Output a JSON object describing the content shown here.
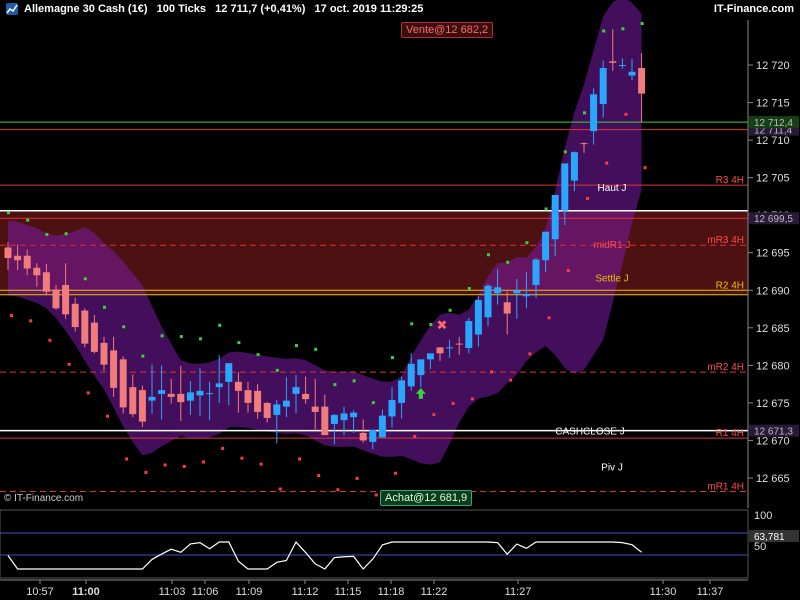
{
  "header": {
    "title": "Allemagne 30 Cash (1€)   100 Ticks   12 711,7 (+0,41%)   17 oct. 2019 11:29:25",
    "brand": "IT-Finance.com",
    "icon": "chart-app-icon"
  },
  "orders": {
    "sell": "Vente@12 682,2",
    "buy": "Achat@12 681,9"
  },
  "copyright": "© IT-Finance.com",
  "colors": {
    "bull": "#2aa6ff",
    "bear": "#f07c7c",
    "band_fill": "#7a1aa6",
    "zone_fill": "#5a1414",
    "support": "#3ad13a",
    "resistance": "#ff3b3b"
  },
  "chart_data": {
    "type": "candlestick",
    "instrument": "Allemagne 30 Cash (1€)",
    "timeframe": "100 Ticks",
    "ylim": [
      12661,
      12726
    ],
    "y_ticks": [
      "12 720",
      "12 715",
      "12 710",
      "12 705",
      "12 700",
      "12 695",
      "12 690",
      "12 685",
      "12 680",
      "12 675",
      "12 670",
      "12 665"
    ],
    "x_ticks": [
      "10:57",
      "11:00",
      "11:03",
      "11:06",
      "11:09",
      "11:12",
      "11:15",
      "11:18",
      "11:22",
      "11:27",
      "11:30",
      "11:37"
    ],
    "candles": [
      [
        12695.7,
        12696.4,
        12692.7,
        12694.3
      ],
      [
        12694.6,
        12696.1,
        12692.7,
        12694.0
      ],
      [
        12694.6,
        12695.4,
        12692.0,
        12692.9
      ],
      [
        12693.0,
        12693.6,
        12690.5,
        12692.0
      ],
      [
        12692.4,
        12693.5,
        12689.4,
        12689.8
      ],
      [
        12690.1,
        12690.7,
        12687.4,
        12687.6
      ],
      [
        12690.7,
        12693.6,
        12686.2,
        12686.8
      ],
      [
        12688.2,
        12689.0,
        12684.5,
        12685.1
      ],
      [
        12687.3,
        12687.6,
        12682.4,
        12682.9
      ],
      [
        12685.7,
        12686.7,
        12681.6,
        12681.8
      ],
      [
        12683.0,
        12683.8,
        12679.3,
        12680.1
      ],
      [
        12682.0,
        12683.8,
        12675.8,
        12677.0
      ],
      [
        12680.8,
        12681.2,
        12673.6,
        12674.4
      ],
      [
        12677.1,
        12678.8,
        12673.1,
        12673.5
      ],
      [
        12676.7,
        12677.3,
        12671.8,
        12672.5
      ],
      [
        12675.3,
        12680.1,
        12673.5,
        12675.8
      ],
      [
        12676.2,
        12680.0,
        12672.8,
        12676.7
      ],
      [
        12676.2,
        12678.2,
        12674.9,
        12675.8
      ],
      [
        12676.2,
        12679.9,
        12672.6,
        12675.1
      ],
      [
        12675.3,
        12677.9,
        12673.4,
        12676.4
      ],
      [
        12676.0,
        12679.6,
        12673.2,
        12676.6
      ],
      [
        12676.2,
        12677.8,
        12672.7,
        12676.3
      ],
      [
        12677.1,
        12681.4,
        12675.0,
        12677.6
      ],
      [
        12677.8,
        12680.0,
        12674.7,
        12680.3
      ],
      [
        12677.8,
        12679.1,
        12673.7,
        12676.6
      ],
      [
        12676.7,
        12677.8,
        12673.7,
        12675.0
      ],
      [
        12676.6,
        12677.5,
        12672.9,
        12673.8
      ],
      [
        12675.0,
        12675.1,
        12672.4,
        12673.0
      ],
      [
        12673.4,
        12675.4,
        12669.6,
        12674.8
      ],
      [
        12674.5,
        12678.4,
        12673.1,
        12675.3
      ],
      [
        12676.2,
        12678.7,
        12673.6,
        12677.1
      ],
      [
        12676.2,
        12678.5,
        12674.9,
        12675.5
      ],
      [
        12674.5,
        12678.2,
        12671.4,
        12673.8
      ],
      [
        12674.5,
        12676.1,
        12672.0,
        12670.7
      ],
      [
        12672.2,
        12673.5,
        12669.5,
        12673.4
      ],
      [
        12672.7,
        12674.5,
        12670.7,
        12673.6
      ],
      [
        12673.1,
        12674.0,
        12671.0,
        12673.7
      ],
      [
        12671.0,
        12672.8,
        12669.7,
        12670.0
      ],
      [
        12669.8,
        12671.1,
        12668.8,
        12671.4
      ],
      [
        12670.4,
        12674.1,
        12670.4,
        12673.3
      ],
      [
        12673.2,
        12677.1,
        12671.7,
        12675.4
      ],
      [
        12675.0,
        12678.5,
        12672.9,
        12678.0
      ],
      [
        12677.2,
        12681.6,
        12676.6,
        12680.2
      ],
      [
        12678.7,
        12680.4,
        12677.1,
        12680.8
      ],
      [
        12680.8,
        12681.5,
        12679.5,
        12681.6
      ],
      [
        12682.4,
        12682.2,
        12680.6,
        12681.6
      ],
      [
        12682.4,
        12683.4,
        12681.0,
        12682.4
      ],
      [
        12682.9,
        12683.8,
        12681.4,
        12682.8
      ],
      [
        12682.3,
        12686.3,
        12681.6,
        12685.9
      ],
      [
        12684.1,
        12689.2,
        12682.5,
        12688.7
      ],
      [
        12686.4,
        12690.8,
        12685.2,
        12690.6
      ],
      [
        12689.6,
        12692.8,
        12688.1,
        12690.4
      ],
      [
        12688.4,
        12689.8,
        12684.1,
        12686.9
      ],
      [
        12689.6,
        12691.5,
        12686.2,
        12690.0
      ],
      [
        12689.2,
        12692.4,
        12687.6,
        12689.5
      ],
      [
        12690.7,
        12694.3,
        12689.0,
        12694.1
      ],
      [
        12694.0,
        12696.9,
        12692.4,
        12697.8
      ],
      [
        12696.8,
        12701.1,
        12694.6,
        12702.7
      ],
      [
        12700.6,
        12704.5,
        12698.7,
        12706.9
      ],
      [
        12704.6,
        12708.5,
        12703.2,
        12708.4
      ],
      [
        12709.6,
        12709.7,
        12708.3,
        12709.5
      ],
      [
        12711.2,
        12716.9,
        12709.4,
        12716.1
      ],
      [
        12714.8,
        12720.6,
        12713.0,
        12719.6
      ],
      [
        12720.5,
        12724.8,
        12719.2,
        12720.3
      ],
      [
        12720.0,
        12720.9,
        12719.5,
        12720.0
      ],
      [
        12718.6,
        12720.8,
        12718.0,
        12719.1
      ],
      [
        12719.6,
        12721.6,
        12712.4,
        12716.2
      ]
    ],
    "levels": [
      {
        "value": 12711.4,
        "label": "12 711,4",
        "tag": true
      },
      {
        "value": 12712.4,
        "label": "12 712,4",
        "tag": true
      },
      {
        "value": 12704.0,
        "label": "R3 4H"
      },
      {
        "value": 12700.6,
        "label": ""
      },
      {
        "value": 12699.6,
        "label": "12 699,5",
        "tag": true
      },
      {
        "value": 12696.0,
        "label": "mR3 4H"
      },
      {
        "value": 12690.0,
        "label": "R2 4H"
      },
      {
        "value": 12689.4,
        "label": ""
      },
      {
        "value": 12679.1,
        "label": "mR2 4H"
      },
      {
        "value": 12671.3,
        "label": "12 671,3",
        "tag": true
      },
      {
        "value": 12670.3,
        "label": "R1 4H"
      },
      {
        "value": 12663.2,
        "label": "mR1 4H"
      }
    ],
    "text_labels": [
      "Haut J",
      "midR1 J",
      "Settle J",
      "CASHCLOSE J",
      "Piv J"
    ],
    "indicator": {
      "value_label": "63,781",
      "y_ticks": [
        "100",
        "50"
      ]
    }
  }
}
